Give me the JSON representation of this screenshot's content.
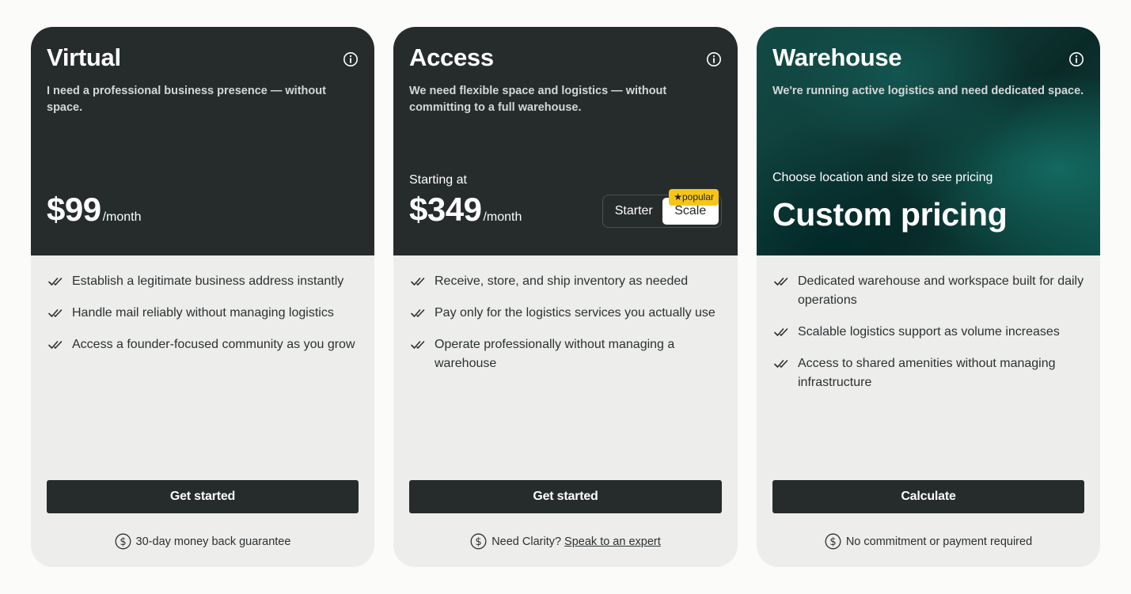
{
  "cards": [
    {
      "title": "Virtual",
      "subtitle": "I need a professional business presence — without space.",
      "price": "$99",
      "per": "/month",
      "features": [
        "Establish a legitimate business address instantly",
        "Handle mail reliably without managing logistics",
        "Access a founder-focused community as you grow"
      ],
      "cta": "Get started",
      "footnote": "30-day money back guarantee"
    },
    {
      "title": "Access",
      "subtitle": "We need flexible space and logistics — without committing to a full warehouse.",
      "starting_label": "Starting at",
      "price": "$349",
      "per": "/month",
      "toggle": {
        "options": [
          "Starter",
          "Scale"
        ],
        "selected": "Scale",
        "badge": "popular"
      },
      "features": [
        "Receive, store, and ship inventory as needed",
        "Pay only for the logistics services you actually use",
        "Operate professionally without managing a warehouse"
      ],
      "cta": "Get started",
      "footnote": "Need Clarity?",
      "footnote_link": "Speak to an expert"
    },
    {
      "title": "Warehouse",
      "subtitle": "We're running active logistics and need dedicated space.",
      "pricing_label": "Choose location and size to see pricing",
      "price": "Custom pricing",
      "features": [
        "Dedicated warehouse and workspace built for daily operations",
        "Scalable logistics support as volume increases",
        "Access to shared amenities without managing infrastructure"
      ],
      "cta": "Calculate",
      "footnote": "No commitment or payment required"
    }
  ],
  "icons": {
    "info": "info-icon",
    "check": "double-check-icon",
    "dollar": "dollar-circle-icon",
    "star": "★"
  },
  "colors": {
    "dark": "#262b2c",
    "card_bg": "#edeeec",
    "badge": "#f5c518",
    "teal": "#0f3e3a"
  }
}
